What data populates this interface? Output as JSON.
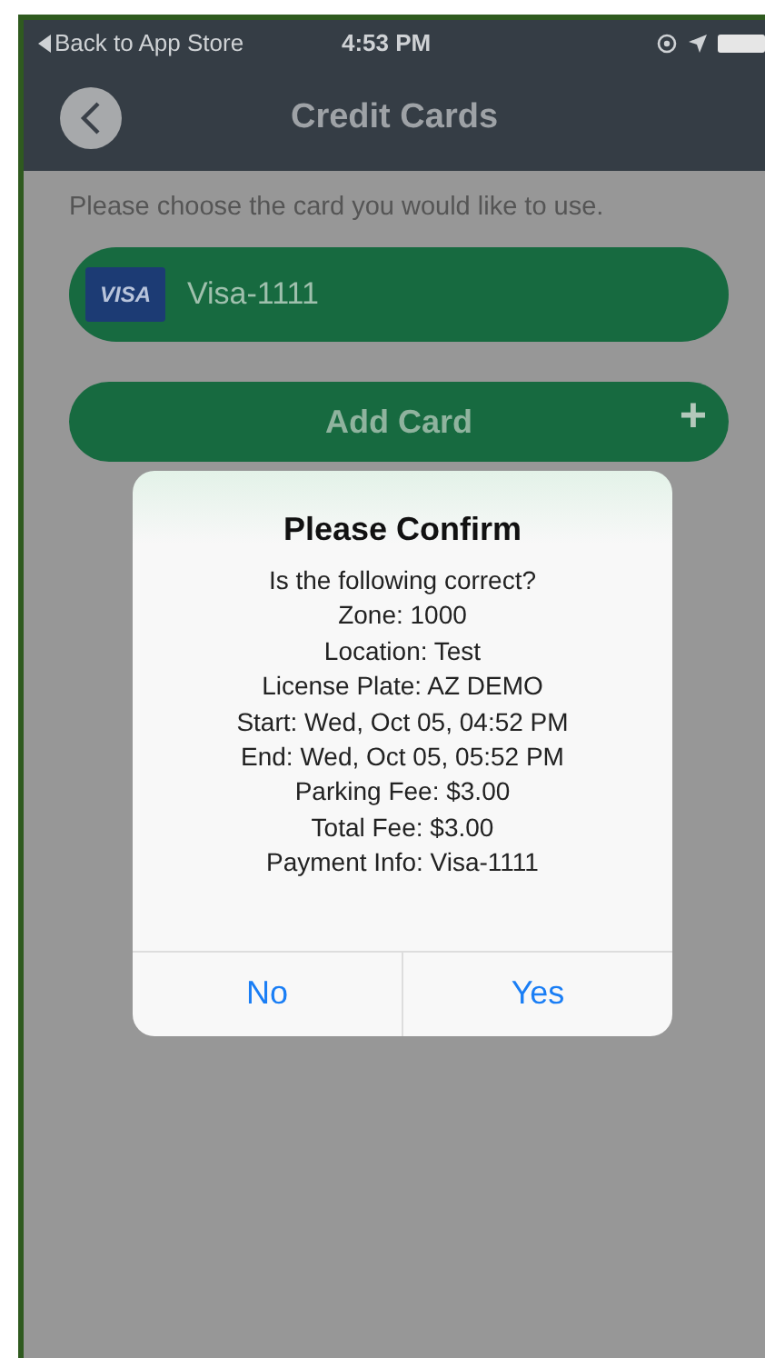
{
  "status_bar": {
    "back_label": "Back to App Store",
    "time": "4:53 PM"
  },
  "nav": {
    "title": "Credit Cards"
  },
  "prompt": "Please choose the card you would like to use.",
  "cards": [
    {
      "brand": "VISA",
      "label": "Visa-1111"
    }
  ],
  "add_button": {
    "label": "Add Card",
    "icon": "+"
  },
  "dialog": {
    "title": "Please Confirm",
    "lines": [
      "Is the following correct?",
      "Zone: 1000",
      "Location: Test",
      "License Plate: AZ DEMO",
      "Start: Wed, Oct 05, 04:52 PM",
      "End: Wed, Oct 05, 05:52 PM",
      "Parking Fee: $3.00",
      "Total Fee: $3.00",
      "Payment Info: Visa-1111"
    ],
    "buttons": [
      "No",
      "Yes"
    ]
  }
}
